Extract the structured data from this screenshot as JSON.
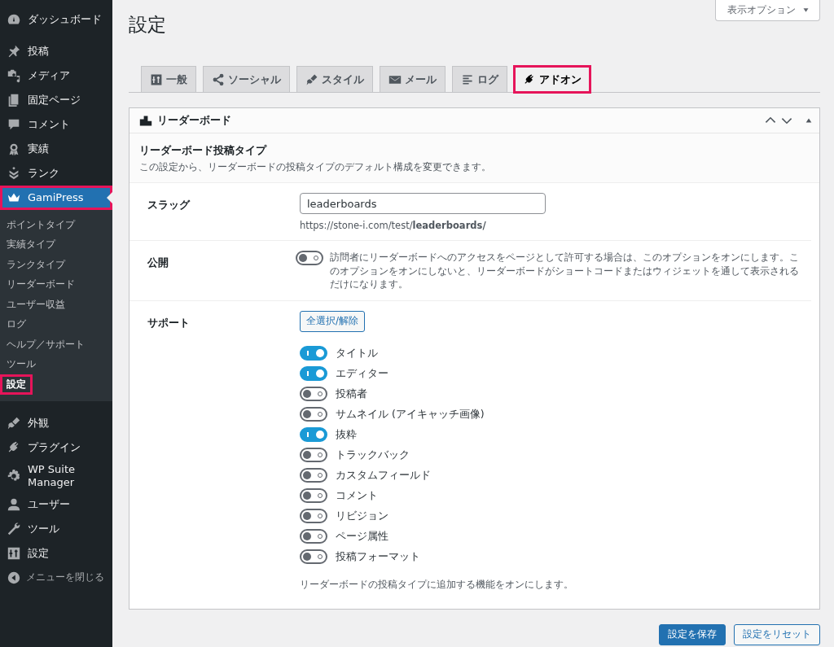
{
  "sidebar": {
    "items": [
      {
        "label": "ダッシュボード",
        "selected": false,
        "highlighted": false
      },
      {
        "label": "投稿",
        "selected": false,
        "highlighted": false
      },
      {
        "label": "メディア",
        "selected": false,
        "highlighted": false
      },
      {
        "label": "固定ページ",
        "selected": false,
        "highlighted": false
      },
      {
        "label": "コメント",
        "selected": false,
        "highlighted": false
      },
      {
        "label": "実績",
        "selected": false,
        "highlighted": false
      },
      {
        "label": "ランク",
        "selected": false,
        "highlighted": false
      },
      {
        "label": "GamiPress",
        "selected": true,
        "highlighted": true,
        "children": [
          {
            "label": "ポイントタイプ",
            "selected": false,
            "highlighted": false
          },
          {
            "label": "実績タイプ",
            "selected": false,
            "highlighted": false
          },
          {
            "label": "ランクタイプ",
            "selected": false,
            "highlighted": false
          },
          {
            "label": "リーダーボード",
            "selected": false,
            "highlighted": false
          },
          {
            "label": "ユーザー収益",
            "selected": false,
            "highlighted": false
          },
          {
            "label": "ログ",
            "selected": false,
            "highlighted": false
          },
          {
            "label": "ヘルプ／サポート",
            "selected": false,
            "highlighted": false
          },
          {
            "label": "ツール",
            "selected": false,
            "highlighted": false
          },
          {
            "label": "設定",
            "selected": true,
            "highlighted": true
          }
        ]
      },
      {
        "label": "外観",
        "selected": false,
        "highlighted": false
      },
      {
        "label": "プラグイン",
        "selected": false,
        "highlighted": false
      },
      {
        "label": "WP Suite Manager",
        "selected": false,
        "highlighted": false
      },
      {
        "label": "ユーザー",
        "selected": false,
        "highlighted": false
      },
      {
        "label": "ツール",
        "selected": false,
        "highlighted": false
      },
      {
        "label": "設定",
        "selected": false,
        "highlighted": false
      }
    ],
    "collapse_label": "メニューを閉じる"
  },
  "screen_options": "表示オプション",
  "page_title": "設定",
  "tabs": [
    {
      "label": "一般",
      "selected": false,
      "highlighted": false
    },
    {
      "label": "ソーシャル",
      "selected": false,
      "highlighted": false
    },
    {
      "label": "スタイル",
      "selected": false,
      "highlighted": false
    },
    {
      "label": "メール",
      "selected": false,
      "highlighted": false
    },
    {
      "label": "ログ",
      "selected": false,
      "highlighted": false
    },
    {
      "label": "アドオン",
      "selected": true,
      "highlighted": true
    }
  ],
  "panel": {
    "title": "リーダーボード",
    "section_title": "リーダーボード投稿タイプ",
    "section_description": "この設定から、リーダーボードの投稿タイプのデフォルト構成を変更できます。",
    "rows": [
      {
        "kind": "text",
        "label": "スラッグ",
        "value": "leaderboards",
        "note": "https://stone-i.com/test/**leaderboards/**"
      },
      {
        "kind": "toggle",
        "label": "公開",
        "on": false,
        "description": "訪問者にリーダーボードへのアクセスをページとして許可する場合は、このオプションをオンにします。このオプションをオンにしないと、リーダーボードがショートコードまたはウィジェットを通して表示されるだけになります。"
      },
      {
        "kind": "toggle_list",
        "label": "サポート",
        "button": "全選択/解除",
        "options": [
          {
            "label": "タイトル",
            "on": true
          },
          {
            "label": "エディター",
            "on": true
          },
          {
            "label": "投稿者",
            "on": false
          },
          {
            "label": "サムネイル (アイキャッチ画像)",
            "on": false
          },
          {
            "label": "抜粋",
            "on": true
          },
          {
            "label": "トラックバック",
            "on": false
          },
          {
            "label": "カスタムフィールド",
            "on": false
          },
          {
            "label": "コメント",
            "on": false
          },
          {
            "label": "リビジョン",
            "on": false
          },
          {
            "label": "ページ属性",
            "on": false
          },
          {
            "label": "投稿フォーマット",
            "on": false
          }
        ],
        "description": "リーダーボードの投稿タイプに追加する機能をオンにします。"
      }
    ]
  },
  "buttons": [
    {
      "label": "設定を保存",
      "kind": "primary"
    },
    {
      "label": "設定をリセット",
      "kind": "secondary"
    }
  ]
}
